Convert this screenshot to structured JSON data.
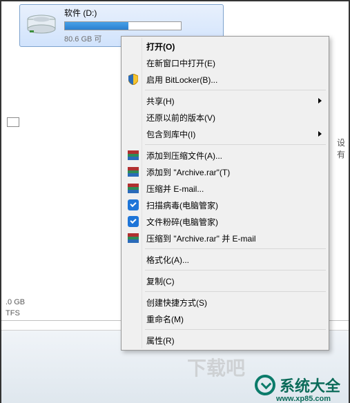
{
  "drive": {
    "name": "软件 (D:)",
    "free_text": "80.6 GB 可",
    "bar_fill_percent": 55
  },
  "bottom_panel": {
    "line1": ".0 GB",
    "line2": "TFS"
  },
  "right_truncated": "设有",
  "menu": {
    "open": "打开(O)",
    "open_new_window": "在新窗口中打开(E)",
    "bitlocker": "启用 BitLocker(B)...",
    "share": "共享(H)",
    "restore": "还原以前的版本(V)",
    "include_library": "包含到库中(I)",
    "add_archive": "添加到压缩文件(A)...",
    "add_to_rar": "添加到 \"Archive.rar\"(T)",
    "compress_email": "压缩并 E-mail...",
    "scan_virus": "扫描病毒(电脑管家)",
    "file_shred": "文件粉碎(电脑管家)",
    "compress_to_email": "压缩到 \"Archive.rar\" 并 E-mail",
    "format": "格式化(A)...",
    "copy": "复制(C)",
    "shortcut": "创建快捷方式(S)",
    "rename": "重命名(M)",
    "properties": "属性(R)"
  },
  "watermark": {
    "main": "系统大全",
    "sub": "www.xp85.com",
    "dl": "下载吧"
  }
}
